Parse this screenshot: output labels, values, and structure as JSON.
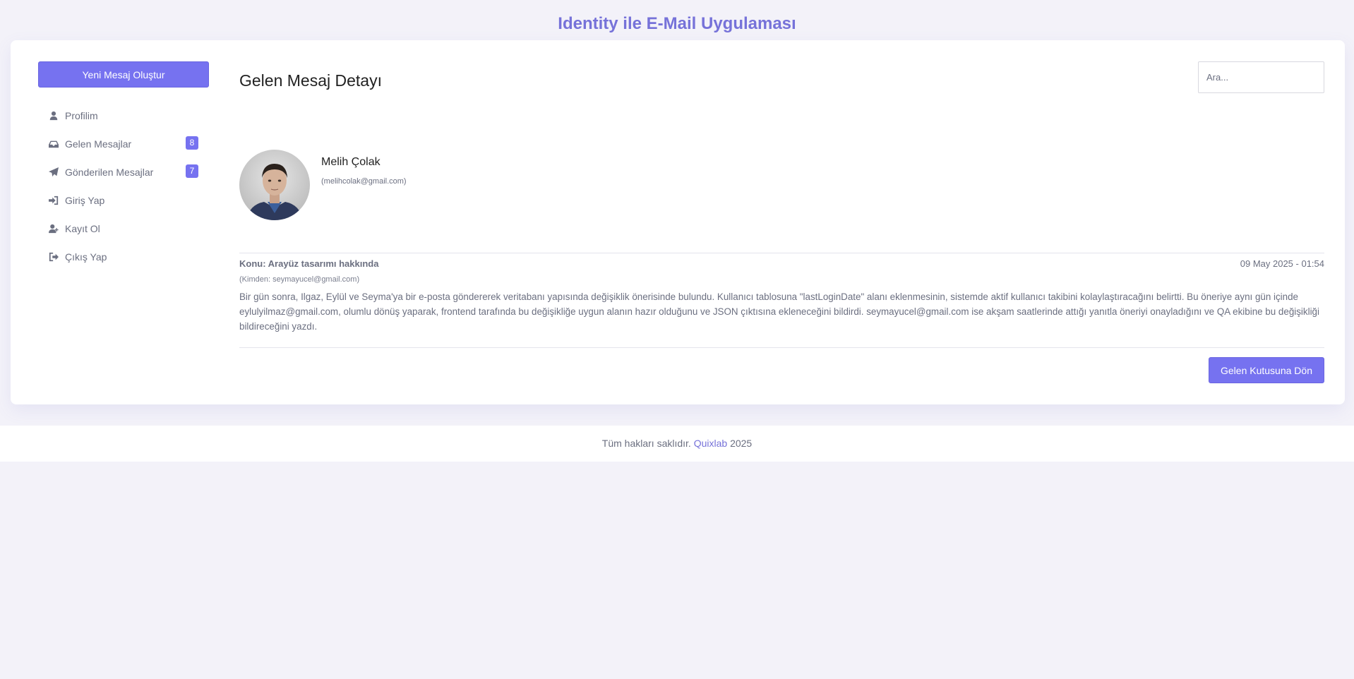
{
  "app": {
    "title": "Identity ile E-Mail Uygulaması"
  },
  "sidebar": {
    "compose_label": "Yeni Mesaj Oluştur",
    "items": [
      {
        "label": "Profilim",
        "icon": "user-icon"
      },
      {
        "label": "Gelen Mesajlar",
        "icon": "inbox-icon",
        "badge": "8"
      },
      {
        "label": "Gönderilen Mesajlar",
        "icon": "paper-plane-icon",
        "badge": "7"
      },
      {
        "label": "Giriş Yap",
        "icon": "sign-in-icon"
      },
      {
        "label": "Kayıt Ol",
        "icon": "user-plus-icon"
      },
      {
        "label": "Çıkış Yap",
        "icon": "sign-out-icon"
      }
    ]
  },
  "main": {
    "title": "Gelen Mesaj Detayı",
    "search_placeholder": "Ara...",
    "sender": {
      "name": "Melih Çolak",
      "email": "(melihcolak@gmail.com)"
    },
    "message": {
      "subject": "Konu: Arayüz tasarımı hakkında",
      "date": "09 May 2025 - 01:54",
      "from": "(Kimden: seymayucel@gmail.com)",
      "body": "Bir gün sonra, Ilgaz, Eylül ve Seyma'ya bir e-posta göndererek veritabanı yapısında değişiklik önerisinde bulundu. Kullanıcı tablosuna \"lastLoginDate\" alanı eklenmesinin, sistemde aktif kullanıcı takibini kolaylaştıracağını belirtti. Bu öneriye aynı gün içinde eylulyilmaz@gmail.com, olumlu dönüş yaparak, frontend tarafında bu değişikliğe uygun alanın hazır olduğunu ve JSON çıktısına ekleneceğini bildirdi. seymayucel@gmail.com ise akşam saatlerinde attığı yanıtla öneriyi onayladığını ve QA ekibine bu değişikliği bildireceğini yazdı."
    },
    "back_label": "Gelen Kutusuna Dön"
  },
  "footer": {
    "text_before": "Tüm hakları saklıdır.",
    "brand": "Quixlab",
    "year": "2025"
  },
  "colors": {
    "accent": "#7672f0",
    "title": "#7672d9",
    "background": "#f3f2f9"
  }
}
